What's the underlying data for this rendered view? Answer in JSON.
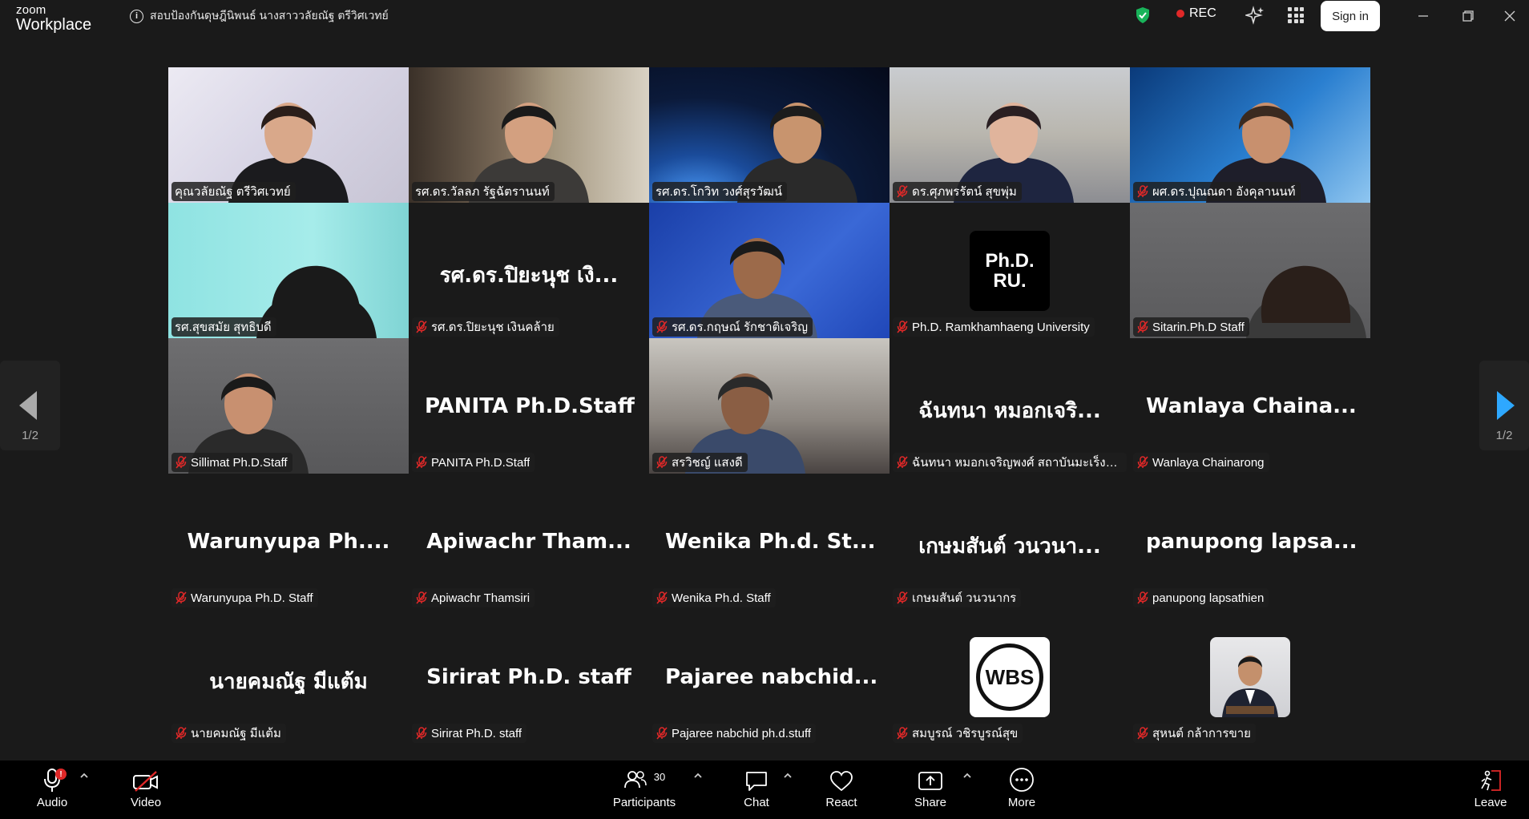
{
  "titlebar": {
    "logo_line1": "zoom",
    "logo_line2": "Workplace",
    "meeting_title": "สอบป้องกันดุษฎีนิพนธ์  นางสาววลัยณัฐ ตรีวิศเวทย์",
    "rec_label": "REC",
    "signin_label": "Sign in"
  },
  "gallery": {
    "tiles": [
      {
        "name": "คุณวลัยณัฐ  ตรีวิศเวทย์",
        "big": "",
        "muted": false,
        "video": "video-purple"
      },
      {
        "name": "รศ.ดร.วัลลภ รัฐฉัตรานนท์",
        "big": "",
        "muted": false,
        "video": "video-office"
      },
      {
        "name": "รศ.ดร.โกวิท  วงศ์สุรวัฒน์",
        "big": "",
        "muted": false,
        "video": "video-earth"
      },
      {
        "name": "ดร.ศุภพรรัตน์  สุขพุ่ม",
        "big": "",
        "muted": true,
        "video": "video-room"
      },
      {
        "name": "ผศ.ดร.ปุณณดา  อังคุลานนท์",
        "big": "",
        "muted": true,
        "video": "video-blue"
      },
      {
        "name": "รศ.สุขสมัย สุทธิบดี",
        "big": "",
        "muted": false,
        "video": "video-cyan"
      },
      {
        "name": "รศ.ดร.ปิยะนุช  เงินคล้าย",
        "big": "รศ.ดร.ปิยะนุช  เงิ...",
        "muted": true,
        "video": ""
      },
      {
        "name": "รศ.ดร.กฤษณ์  รักชาติเจริญ",
        "big": "",
        "muted": true,
        "video": "video-ru"
      },
      {
        "name": "Ph.D. Ramkhamhaeng University",
        "big": "",
        "muted": true,
        "video": "logo-phdru"
      },
      {
        "name": "Sitarin.Ph.D Staff",
        "big": "",
        "muted": true,
        "video": "video-grey"
      },
      {
        "name": "Sillimat Ph.D.Staff",
        "big": "",
        "muted": true,
        "video": "video-grey2"
      },
      {
        "name": "PANITA Ph.D.Staff",
        "big": "PANITA Ph.D.Staff",
        "muted": true,
        "video": ""
      },
      {
        "name": "สรวิชญ์  แสงดี",
        "big": "",
        "muted": true,
        "video": "video-man"
      },
      {
        "name": "ฉันทนา หมอกเจริญพงศ์ สถาบันมะเร็งแห่งช...",
        "big": "ฉันทนา หมอกเจริ...",
        "muted": true,
        "video": ""
      },
      {
        "name": "Wanlaya Chainarong",
        "big": "Wanlaya  Chaina...",
        "muted": true,
        "video": ""
      },
      {
        "name": "Warunyupa Ph.D. Staff",
        "big": "Warunyupa  Ph....",
        "muted": true,
        "video": ""
      },
      {
        "name": "Apiwachr Thamsiri",
        "big": "Apiwachr  Tham...",
        "muted": true,
        "video": ""
      },
      {
        "name": "Wenika Ph.d. Staff",
        "big": "Wenika  Ph.d.  St...",
        "muted": true,
        "video": ""
      },
      {
        "name": "เกษมสันต์ วนวนากร",
        "big": "เกษมสันต์ วนวนา...",
        "muted": true,
        "video": ""
      },
      {
        "name": "panupong lapsathien",
        "big": "panupong  lapsa...",
        "muted": true,
        "video": ""
      },
      {
        "name": "นายคมณัฐ มีแต้ม",
        "big": "นายคมณัฐ มีแต้ม",
        "muted": true,
        "video": ""
      },
      {
        "name": "Sirirat Ph.D. staff",
        "big": "Sirirat Ph.D. staff",
        "muted": true,
        "video": ""
      },
      {
        "name": "Pajaree nabchid ph.d.stuff",
        "big": "Pajaree  nabchid...",
        "muted": true,
        "video": ""
      },
      {
        "name": "สมบูรณ์ วชิรบูรณ์สุข",
        "big": "",
        "muted": true,
        "video": "logo-wbs"
      },
      {
        "name": "สุหนต์ กล้าการขาย",
        "big": "",
        "muted": true,
        "video": "logo-portrait"
      }
    ],
    "phdru_logo_line1": "Ph.D.",
    "phdru_logo_line2": "RU.",
    "wbs_logo": "WBS"
  },
  "nav": {
    "left_page": "1/2",
    "right_page": "1/2"
  },
  "toolbar": {
    "audio_label": "Audio",
    "audio_badge": "!",
    "video_label": "Video",
    "participants_label": "Participants",
    "participants_count": "30",
    "chat_label": "Chat",
    "react_label": "React",
    "share_label": "Share",
    "more_label": "More",
    "leave_label": "Leave"
  },
  "colors": {
    "active_speaker": "#23d98a",
    "rec_dot": "#e02828",
    "mute_red": "#e02828",
    "nav_arrow_active": "#2ea8ff",
    "shield_green": "#19b35a"
  }
}
